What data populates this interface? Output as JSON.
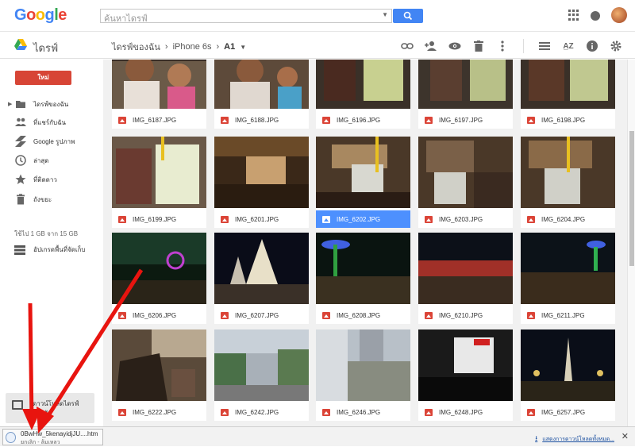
{
  "header": {
    "logo_letters": [
      "G",
      "o",
      "o",
      "g",
      "l",
      "e"
    ],
    "search_placeholder": "ค้นหาไดรฟ์"
  },
  "subheader": {
    "drive_label": "ไดรฟ์",
    "breadcrumb": [
      "ไดรฟ์ของฉัน",
      "iPhone 6s",
      "A1"
    ]
  },
  "sidebar": {
    "new_label": "ใหม่",
    "items": [
      {
        "label": "ไดรฟ์ของฉัน",
        "icon": "folder-icon"
      },
      {
        "label": "ที่แชร์กับฉัน",
        "icon": "people-icon"
      },
      {
        "label": "Google รูปภาพ",
        "icon": "photos-icon"
      },
      {
        "label": "ล่าสุด",
        "icon": "clock-icon"
      },
      {
        "label": "ที่ติดดาว",
        "icon": "star-icon"
      },
      {
        "label": "ถังขยะ",
        "icon": "trash-icon"
      }
    ],
    "storage": "ใช้ไป 1 GB จาก 15 GB",
    "upgrade_label": "อัปเกรดพื้นที่จัดเก็บ",
    "backup_label_line1": "ดาวน์โหลดไดรฟ์",
    "backup_label_line2": "สำหรับ"
  },
  "grid": {
    "files": [
      {
        "name": "IMG_6187.JPG",
        "selected": false
      },
      {
        "name": "IMG_6188.JPG",
        "selected": false
      },
      {
        "name": "IMG_6196.JPG",
        "selected": false
      },
      {
        "name": "IMG_6197.JPG",
        "selected": false
      },
      {
        "name": "IMG_6198.JPG",
        "selected": false
      },
      {
        "name": "IMG_6199.JPG",
        "selected": false
      },
      {
        "name": "IMG_6201.JPG",
        "selected": false
      },
      {
        "name": "IMG_6202.JPG",
        "selected": true
      },
      {
        "name": "IMG_6203.JPG",
        "selected": false
      },
      {
        "name": "IMG_6204.JPG",
        "selected": false
      },
      {
        "name": "IMG_6206.JPG",
        "selected": false
      },
      {
        "name": "IMG_6207.JPG",
        "selected": false
      },
      {
        "name": "IMG_6208.JPG",
        "selected": false
      },
      {
        "name": "IMG_6210.JPG",
        "selected": false
      },
      {
        "name": "IMG_6211.JPG",
        "selected": false
      },
      {
        "name": "IMG_6222.JPG",
        "selected": false
      },
      {
        "name": "IMG_6242.JPG",
        "selected": false
      },
      {
        "name": "IMG_6246.JPG",
        "selected": false
      },
      {
        "name": "IMG_6248.JPG",
        "selected": false
      },
      {
        "name": "IMG_6257.JPG",
        "selected": false
      }
    ]
  },
  "download_bar": {
    "file_name": "0BwHw_5kenayidjJU....htm",
    "status": "ยกเลิก - ล้มเหลว",
    "show_all": "แสดงการดาวน์โหลดทั้งหมด..."
  },
  "colors": {
    "accent": "#4285f4",
    "new_button": "#d74536",
    "selected": "#4d90fe",
    "annotation_arrow": "#e8140f"
  }
}
